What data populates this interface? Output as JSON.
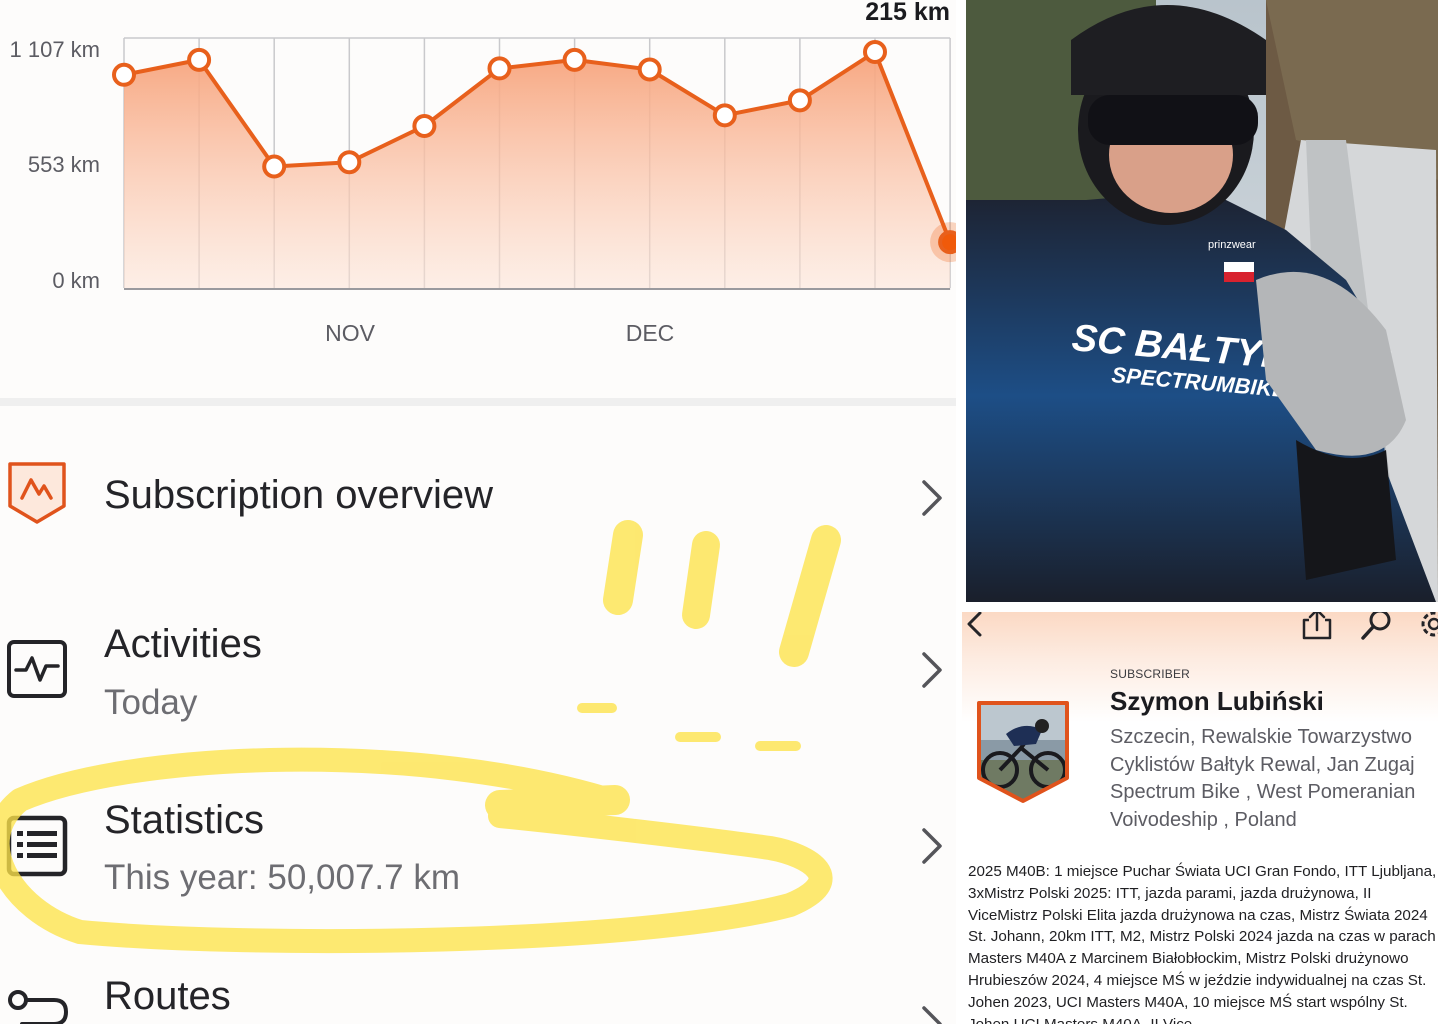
{
  "chart_data": {
    "type": "area",
    "series": [
      {
        "values": [
          1000,
          1070,
          570,
          590,
          760,
          1030,
          1070,
          1025,
          810,
          880,
          1107,
          215
        ]
      }
    ],
    "x_tick_labels": [
      "NOV",
      "DEC"
    ],
    "y_tick_labels": [
      "1 107 km",
      "553 km",
      "0 km"
    ],
    "ylim": [
      0,
      1107
    ],
    "peak_label": "215 km",
    "grid": true,
    "colors": {
      "line": "#e8601c",
      "fill": "#f7a27a",
      "current_point": "#f05a0a"
    }
  },
  "menu": {
    "subscription": {
      "title": "Subscription overview"
    },
    "activities": {
      "title": "Activities",
      "subtitle": "Today"
    },
    "statistics": {
      "title": "Statistics",
      "subtitle": "This year: 50,007.7 km"
    },
    "routes": {
      "title": "Routes"
    }
  },
  "icons": {
    "subscription": "strava-badge-icon",
    "activities": "activity-pulse-icon",
    "statistics": "statistics-list-icon",
    "routes": "route-icon",
    "chevron": "chevron-right-icon",
    "back": "chevron-left-icon",
    "share": "share-icon",
    "search": "search-icon",
    "settings": "gear-icon"
  },
  "profile": {
    "badge": "SUBSCRIBER",
    "name": "Szymon Lubiński",
    "location": "Szczecin, Rewalskie Towarzystwo Cyklistów Bałtyk Rewal, Jan Zugaj Spectrum Bike , West Pomeranian Voivodeship , Poland",
    "bio": "2025 M40B: 1 miejsce Puchar Świata UCI Gran Fondo, ITT Ljubljana, 3xMistrz Polski 2025:  ITT, jazda parami, jazda drużynowa, II ViceMistrz Polski Elita jazda drużynowa na czas, Mistrz Świata 2024 St. Johann, 20km ITT, M2, Mistrz Polski 2024 jazda na czas w parach Masters M40A z Marcinem Białobłockim, Mistrz Polski drużynowo Hrubieszów 2024, 4 miejsce MŚ w jeździe indywidualnej na czas St. Johen 2023, UCI Masters M40A, 10 miejsce MŚ start wspólny St. Johen UCI Masters M40A, II Vice"
  },
  "photo": {
    "jersey_text_1": "SC BAŁTYK REW",
    "jersey_text_2": "SPECTRUMBIKE",
    "logo_text": "prinzwear"
  }
}
